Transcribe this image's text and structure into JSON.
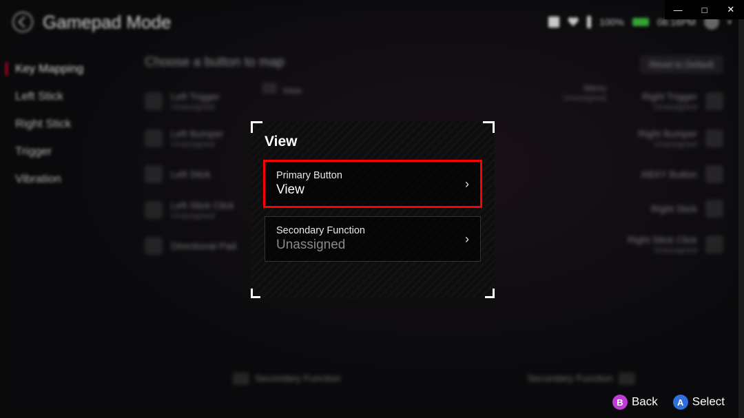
{
  "window": {
    "min": "—",
    "max": "□",
    "close": "✕"
  },
  "header": {
    "title": "Gamepad Mode",
    "battery_pct": "100%",
    "time": "06:16PM"
  },
  "sidebar": {
    "items": [
      {
        "label": "Key Mapping",
        "active": true
      },
      {
        "label": "Left Stick"
      },
      {
        "label": "Right Stick"
      },
      {
        "label": "Trigger"
      },
      {
        "label": "Vibration"
      }
    ]
  },
  "main": {
    "prompt": "Choose a button to map",
    "reset": "Reset to Default",
    "top_left_label": "View",
    "top_right_label": "Menu",
    "top_right_sub": "Unassigned",
    "left_rows": [
      {
        "label": "Left Trigger",
        "sub": "Unassigned"
      },
      {
        "label": "Left Bumper",
        "sub": "Unassigned"
      },
      {
        "label": "Left Stick"
      },
      {
        "label": "Left Stick Click",
        "sub": "Unassigned"
      },
      {
        "label": "Directional Pad"
      }
    ],
    "right_rows": [
      {
        "label": "Right Trigger",
        "sub": "Unassigned"
      },
      {
        "label": "Right Bumper",
        "sub": "Unassigned"
      },
      {
        "label": "ABXY Button"
      },
      {
        "label": "Right Stick"
      },
      {
        "label": "Right Stick Click",
        "sub": "Unassigned"
      }
    ],
    "bottom_left": "Secondary Function",
    "bottom_right": "Secondary Function"
  },
  "modal": {
    "title": "View",
    "primary_label": "Primary Button",
    "primary_value": "View",
    "secondary_label": "Secondary Function",
    "secondary_value": "Unassigned"
  },
  "footer": {
    "back_glyph": "B",
    "back": "Back",
    "select_glyph": "A",
    "select": "Select"
  }
}
